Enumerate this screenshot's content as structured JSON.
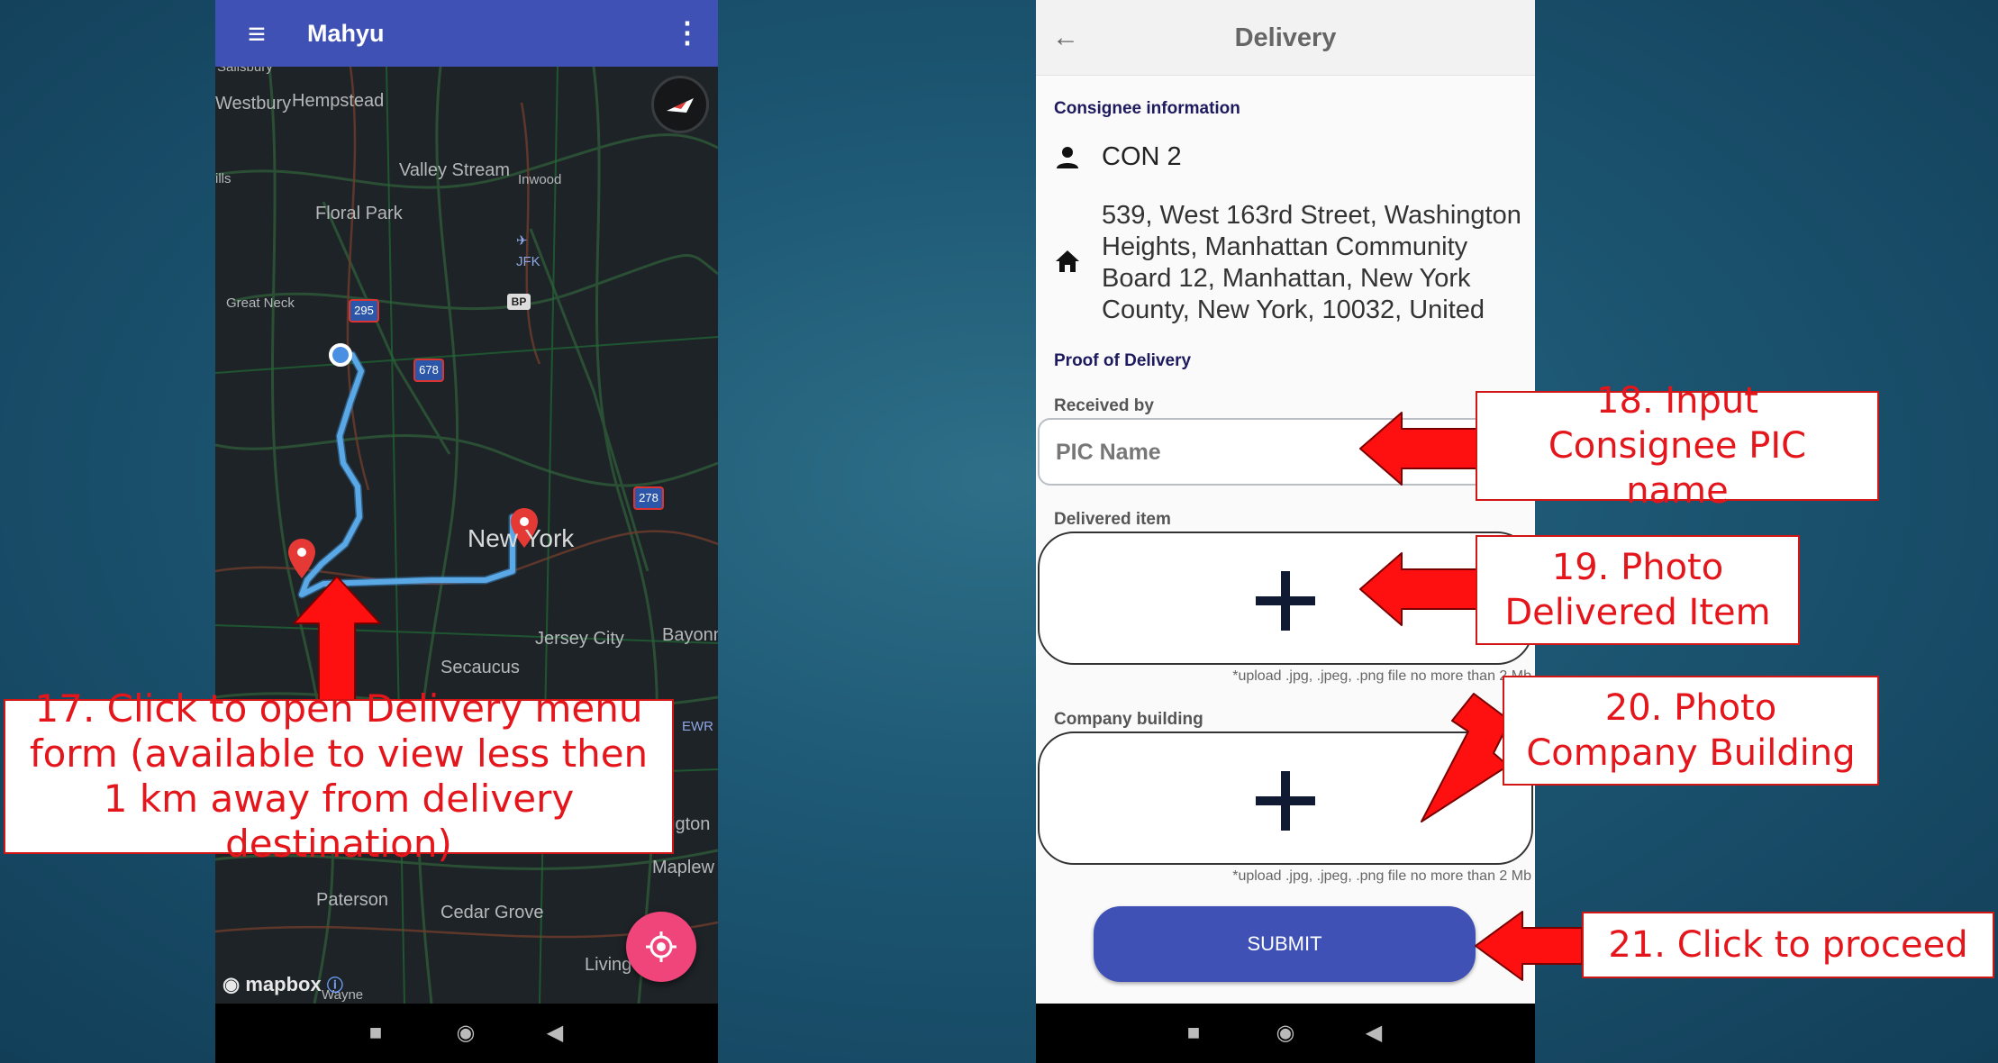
{
  "map_app": {
    "title": "Mahyu",
    "map_labels": {
      "salsbury": "Salisbury",
      "westbury": "Westbury",
      "hempstead": "Hempstead",
      "valley_stream": "Valley Stream",
      "hills": "ills",
      "inwood": "Inwood",
      "floral_park": "Floral Park",
      "jfk": "JFK",
      "great_neck": "Great Neck",
      "bp": "BP",
      "i295": "295",
      "i678": "678",
      "i278": "278",
      "new_york": "New York",
      "jersey_city": "Jersey City",
      "bayonne": "Bayonn",
      "secaucus": "Secaucus",
      "ewr": "EWR",
      "hgton": "igton",
      "maplewood": "Maplew",
      "paterson": "Paterson",
      "cedar_grove": "Cedar Grove",
      "living": "Living",
      "wayne": "Wayne",
      "mapbox": "mapbox"
    },
    "icons": [
      "menu-icon",
      "more-vert-icon",
      "compass-icon",
      "my-location-icon",
      "stop-icon",
      "home-circle-icon",
      "back-triangle-icon"
    ]
  },
  "delivery_form": {
    "title": "Delivery",
    "consignee_section": "Consignee information",
    "consignee_name": "CON 2",
    "address": "539, West 163rd Street, Washington Heights, Manhattan Community Board 12, Manhattan, New York County, New York, 10032, United",
    "proof_section": "Proof of Delivery",
    "received_by_label": "Received by",
    "received_by_placeholder": "PIC Name",
    "delivered_item_label": "Delivered item",
    "upload_note": "*upload .jpg, .jpeg, .png file no more than 2 Mb",
    "company_building_label": "Company building",
    "submit_label": "SUBMIT"
  },
  "callouts": {
    "c17": "17. Click to open Delivery menu form (available to view less then 1 km away from delivery destination)",
    "c18": "18. Input Consignee PIC name",
    "c19": "19. Photo Delivered Item",
    "c20": "20. Photo Company Building",
    "c21": "21. Click to proceed"
  },
  "colors": {
    "appbar": "#3f51b5",
    "route": "#5aa9e6",
    "marker": "#e53935",
    "fab": "#f0457a",
    "callout_text": "#e4151b",
    "arrow": "#ff1010"
  }
}
